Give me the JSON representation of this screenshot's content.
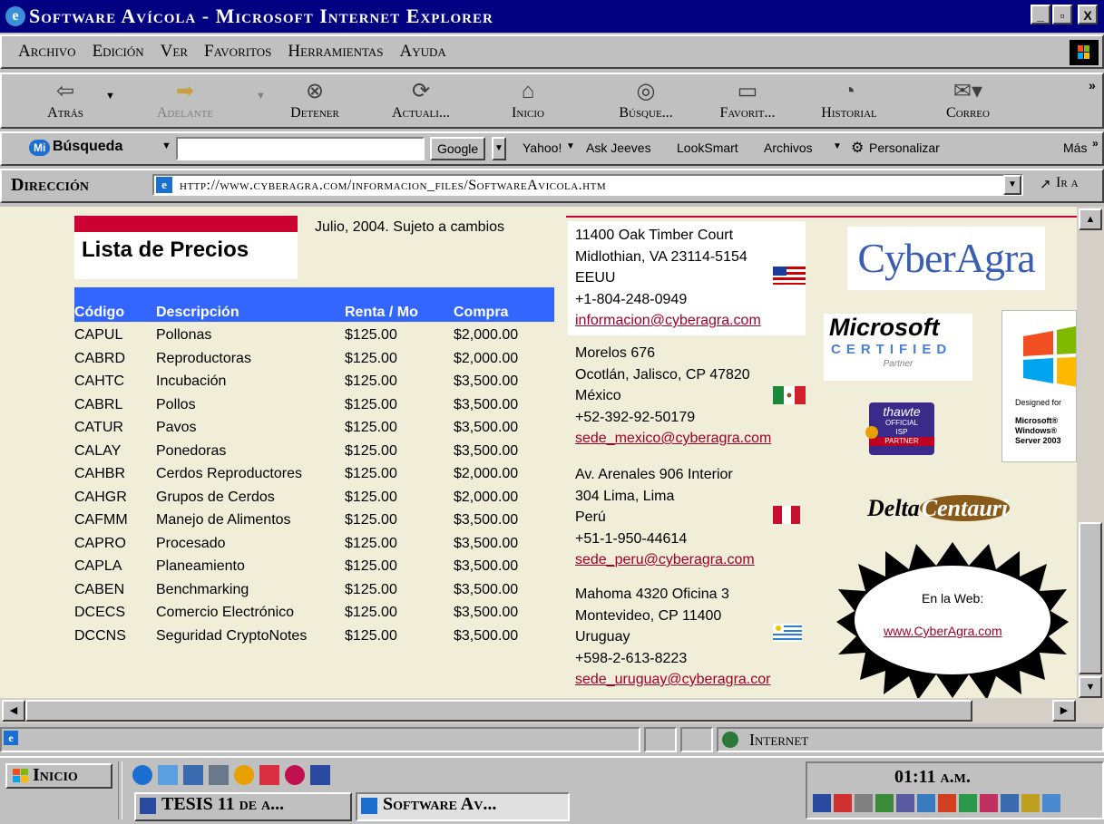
{
  "window": {
    "title": "Software Avícola - Microsoft Internet Explorer",
    "controls": [
      "_",
      "▫",
      "X"
    ]
  },
  "menu": [
    "Archivo",
    "Edición",
    "Ver",
    "Favoritos",
    "Herramientas",
    "Ayuda"
  ],
  "toolbar": {
    "back": "Atrás",
    "forward": "Adelante",
    "stop": "Detener",
    "refresh": "Actuali...",
    "home": "Inicio",
    "search": "Búsque...",
    "favorites": "Favorit...",
    "history": "Historial",
    "mail": "Correo",
    "more": "»"
  },
  "searchbar": {
    "logo": "Mi",
    "label": "Búsqueda",
    "input_value": "",
    "engine": "Google",
    "links": [
      "Yahoo!",
      "Ask Jeeves",
      "LookSmart",
      "Archivos",
      "Personalizar"
    ],
    "more": "Más"
  },
  "address": {
    "label": "Dirección",
    "url": "http://www.cyberagra.com/informacion_files/SoftwareAvicola.htm",
    "go": "Ir a"
  },
  "page": {
    "price_list_title": "Lista de Precios",
    "date_note": "Julio, 2004. Sujeto a cambios",
    "headers": [
      "Código",
      "Descripción",
      "Renta / Mo",
      "Compra"
    ],
    "rows": [
      [
        "CAPUL",
        "Pollonas",
        "$125.00",
        "$2,000.00"
      ],
      [
        "CABRD",
        "Reproductoras",
        "$125.00",
        "$2,000.00"
      ],
      [
        "CAHTC",
        "Incubación",
        "$125.00",
        "$3,500.00"
      ],
      [
        "CABRL",
        "Pollos",
        "$125.00",
        "$3,500.00"
      ],
      [
        "CATUR",
        "Pavos",
        "$125.00",
        "$3,500.00"
      ],
      [
        "CALAY",
        "Ponedoras",
        "$125.00",
        "$3,500.00"
      ],
      [
        "CAHBR",
        "Cerdos Reproductores",
        "$125.00",
        "$2,000.00"
      ],
      [
        "CAHGR",
        "Grupos de Cerdos",
        "$125.00",
        "$2,000.00"
      ],
      [
        "CAFMM",
        "Manejo de Alimentos",
        "$125.00",
        "$3,500.00"
      ],
      [
        "CAPRO",
        "Procesado",
        "$125.00",
        "$3,500.00"
      ],
      [
        "CAPLA",
        "Planeamiento",
        "$125.00",
        "$3,500.00"
      ],
      [
        "CABEN",
        "Benchmarking",
        "$125.00",
        "$3,500.00"
      ],
      [
        "DCECS",
        "Comercio Electrónico",
        "$125.00",
        "$3,500.00"
      ],
      [
        "DCCNS",
        "Seguridad CryptoNotes",
        "$125.00",
        "$3,500.00"
      ]
    ],
    "offices": [
      {
        "lines": [
          "11400 Oak Timber Court",
          "Midlothian, VA 23114-5154",
          "EEUU",
          "+1-804-248-0949"
        ],
        "email": "informacion@cyberagra.com",
        "flag": "usa-flag"
      },
      {
        "lines": [
          "Morelos 676",
          "Ocotlán, Jalisco, CP 47820",
          "México",
          "+52-392-92-50179"
        ],
        "email": "sede_mexico@cyberagra.com",
        "flag": "mexico-flag"
      },
      {
        "lines": [
          "Av. Arenales 906 Interior",
          "304 Lima, Lima",
          "Perú",
          "+51-1-950-44614"
        ],
        "email": "sede_peru@cyberagra.com",
        "flag": "peru-flag"
      },
      {
        "lines": [
          "Mahoma 4320 Oficina 3",
          "Montevideo, CP 11400",
          "Uruguay",
          "+598-2-613-8223"
        ],
        "email": "sede_uruguay@cyberagra.cor",
        "flag": "uruguay-flag"
      }
    ],
    "logos": {
      "cyberagra": "CyberAgra",
      "microsoft": "Microsoft",
      "certified": "CERTIFIED",
      "partner": "Partner",
      "thawte": "thawte",
      "thawte_sub1": "OFFICIAL",
      "thawte_sub2": "ISP",
      "thawte_sub3": "PARTNER",
      "windows_designed": "Designed for",
      "windows_server": "Microsoft® Windows® Server 2003",
      "delta1": "Delta",
      "delta2": "Centauri"
    },
    "web_badge": {
      "label": "En la Web:",
      "link": "www.CyberAgra.com"
    }
  },
  "statusbar": {
    "zone": "Internet"
  },
  "taskbar": {
    "start": "Inicio",
    "clock": "01:11 a.m.",
    "tasks": [
      "TESIS 11 de a...",
      "Software Av..."
    ]
  },
  "colors": {
    "titlebar": "#000080",
    "page_bg": "#f0edd9",
    "table_header": "#3366ff",
    "title_red": "#cc0033",
    "link": "#a0002a"
  }
}
